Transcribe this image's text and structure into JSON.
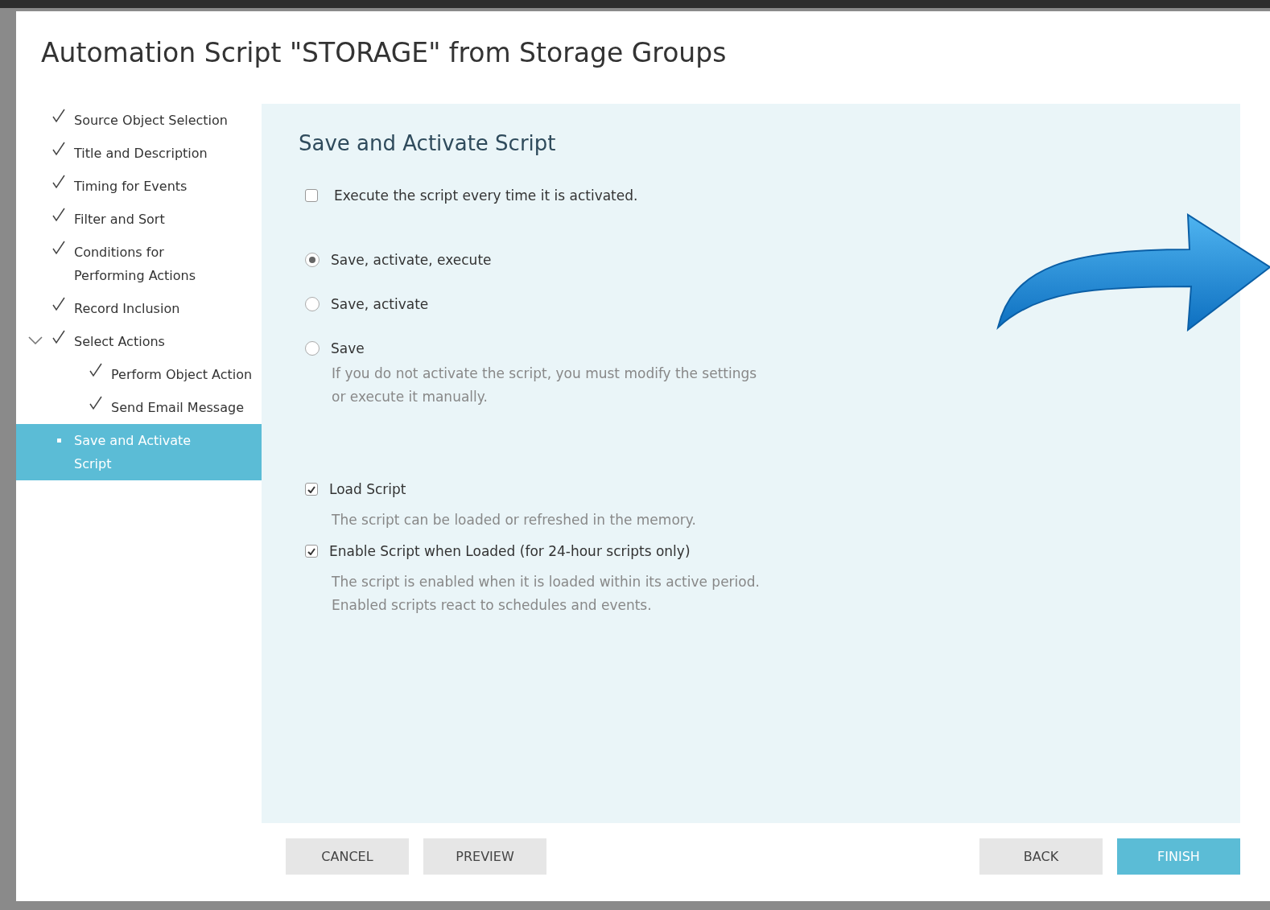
{
  "dialog": {
    "title": "Automation Script \"STORAGE\" from Storage Groups"
  },
  "steps": [
    {
      "label": "Source Object Selection",
      "done": true,
      "selected": false
    },
    {
      "label": "Title and Description",
      "done": true,
      "selected": false
    },
    {
      "label": "Timing for Events",
      "done": true,
      "selected": false
    },
    {
      "label": "Filter and Sort",
      "done": true,
      "selected": false
    },
    {
      "label": "Conditions for Performing Actions",
      "done": true,
      "selected": false
    },
    {
      "label": "Record Inclusion",
      "done": true,
      "selected": false
    },
    {
      "label": "Select Actions",
      "done": true,
      "selected": false,
      "expanded": true,
      "children": [
        {
          "label": "Perform Object Action",
          "done": true,
          "selected": false
        },
        {
          "label": "Send Email Message",
          "done": true,
          "selected": false
        }
      ]
    },
    {
      "label": "Save and Activate Script",
      "done": false,
      "selected": true
    }
  ],
  "panel": {
    "heading": "Save and Activate Script",
    "execute_option": {
      "label": "Execute the script every time it is activated.",
      "checked": false
    },
    "save_modes": [
      {
        "label": "Save, activate, execute",
        "selected": true
      },
      {
        "label": "Save, activate",
        "selected": false
      },
      {
        "label": "Save",
        "selected": false
      }
    ],
    "save_note": "If you do not activate the script, you must modify the settings or execute it manually.",
    "load_options": [
      {
        "label": "Load Script",
        "checked": true,
        "description": "The script can be loaded or refreshed in the memory."
      },
      {
        "label": "Enable Script when Loaded (for 24-hour scripts only)",
        "checked": true,
        "description": "The script is enabled when it is loaded within its active period. Enabled scripts react to schedules and events."
      }
    ]
  },
  "left_buttons": [
    {
      "label": "CANCEL",
      "kind": "secondary"
    },
    {
      "label": "PREVIEW",
      "kind": "secondary"
    }
  ],
  "right_buttons": [
    {
      "label": "BACK",
      "kind": "secondary"
    },
    {
      "label": "FINISH",
      "kind": "primary"
    }
  ]
}
